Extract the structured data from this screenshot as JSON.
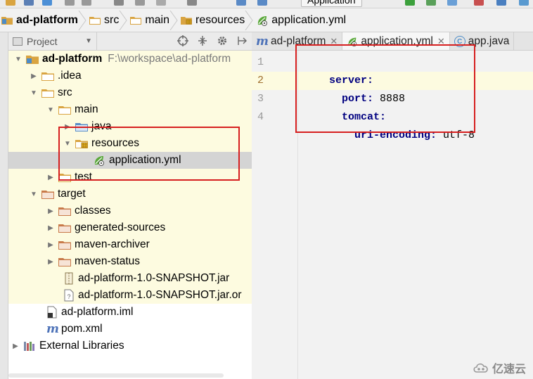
{
  "toolbar": {
    "run_config_label": "Application"
  },
  "breadcrumb": [
    {
      "label": "ad-platform",
      "kind": "project"
    },
    {
      "label": "src",
      "kind": "folder"
    },
    {
      "label": "main",
      "kind": "folder"
    },
    {
      "label": "resources",
      "kind": "resources-folder"
    },
    {
      "label": "application.yml",
      "kind": "spring-file"
    }
  ],
  "project_panel": {
    "view_label": "Project",
    "icons": [
      "target-icon",
      "collapse-icon",
      "gear-icon",
      "pin-icon"
    ]
  },
  "tree": {
    "root_label": "ad-platform",
    "root_path": "F:\\workspace\\ad-platform",
    "items": {
      "idea": ".idea",
      "src": "src",
      "main": "main",
      "java": "java",
      "resources": "resources",
      "application_yml": "application.yml",
      "test": "test",
      "target": "target",
      "classes": "classes",
      "generated_sources": "generated-sources",
      "maven_archiver": "maven-archiver",
      "maven_status": "maven-status",
      "jar": "ad-platform-1.0-SNAPSHOT.jar",
      "jar_original": "ad-platform-1.0-SNAPSHOT.jar.or",
      "iml": "ad-platform.iml",
      "pom": "pom.xml",
      "external_libraries": "External Libraries"
    }
  },
  "editor": {
    "tabs": [
      {
        "label": "ad-platform",
        "icon": "maven-m-icon"
      },
      {
        "label": "application.yml",
        "icon": "spring-leaf-icon",
        "active": true
      },
      {
        "label": "app.java",
        "icon": "class-c-icon"
      }
    ],
    "line_numbers": [
      "1",
      "2",
      "3",
      "4"
    ],
    "lines": [
      {
        "key": "server:",
        "value": ""
      },
      {
        "key": "port:",
        "value": " 8888"
      },
      {
        "key": "tomcat:",
        "value": ""
      },
      {
        "key": "uri-encoding:",
        "value": " utf-8"
      }
    ]
  },
  "watermark": {
    "text": "亿速云"
  },
  "colors": {
    "highlight_box": "#d61f1f",
    "selected_row": "#d4d4d4",
    "module_row": "#fdfbe0",
    "yaml_key": "#000080",
    "folder": "#d9a441",
    "excluded_folder": "#c87a4a"
  }
}
